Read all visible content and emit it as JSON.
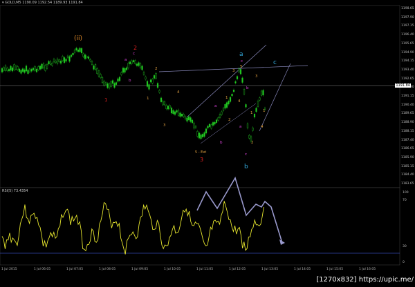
{
  "main_header": {
    "symbol": "▾ GOLD,M5",
    "ohlc": "1190.09 1192.54 1189.93 1191.84"
  },
  "rsi_header": {
    "label": "RSI(5) 73.4354"
  },
  "current_price": "1191.84",
  "price_axis": [
    "1198.65",
    "1197.90",
    "1197.15",
    "1196.40",
    "1195.65",
    "1194.90",
    "1194.15",
    "1193.40",
    "1192.65",
    "1191.90",
    "1191.15",
    "1190.40",
    "1189.65",
    "1188.90",
    "1188.15",
    "1187.40",
    "1186.65",
    "1185.90",
    "1185.15",
    "1184.40",
    "1183.65"
  ],
  "rsi_axis": [
    "100",
    "70",
    "30",
    "0"
  ],
  "time_axis": [
    "1 Jul 2015",
    "1 Jul 06:05",
    "1 Jul 07:05",
    "1 Jul 08:05",
    "1 Jul 09:05",
    "1 Jul 10:05",
    "1 Jul 11:05",
    "1 Jul 12:05",
    "1 Jul 13:05",
    "1 Jul 14:05",
    "1 Jul 15:05",
    "1 Jul 16:05"
  ],
  "wave_labels": {
    "ii": "(ii)",
    "two_red": "2",
    "one_red": "1",
    "three_red": "3",
    "a_cyan": "a",
    "b_cyan": "b",
    "c_cyan": "c",
    "ext": "5 - Ext"
  },
  "watermark": "[1270x832] https://upic.me/",
  "colors": {
    "bull": "#22cc22",
    "bear": "#22cc22",
    "rsi": "#e6e62e",
    "proj": "#9999cc"
  }
}
